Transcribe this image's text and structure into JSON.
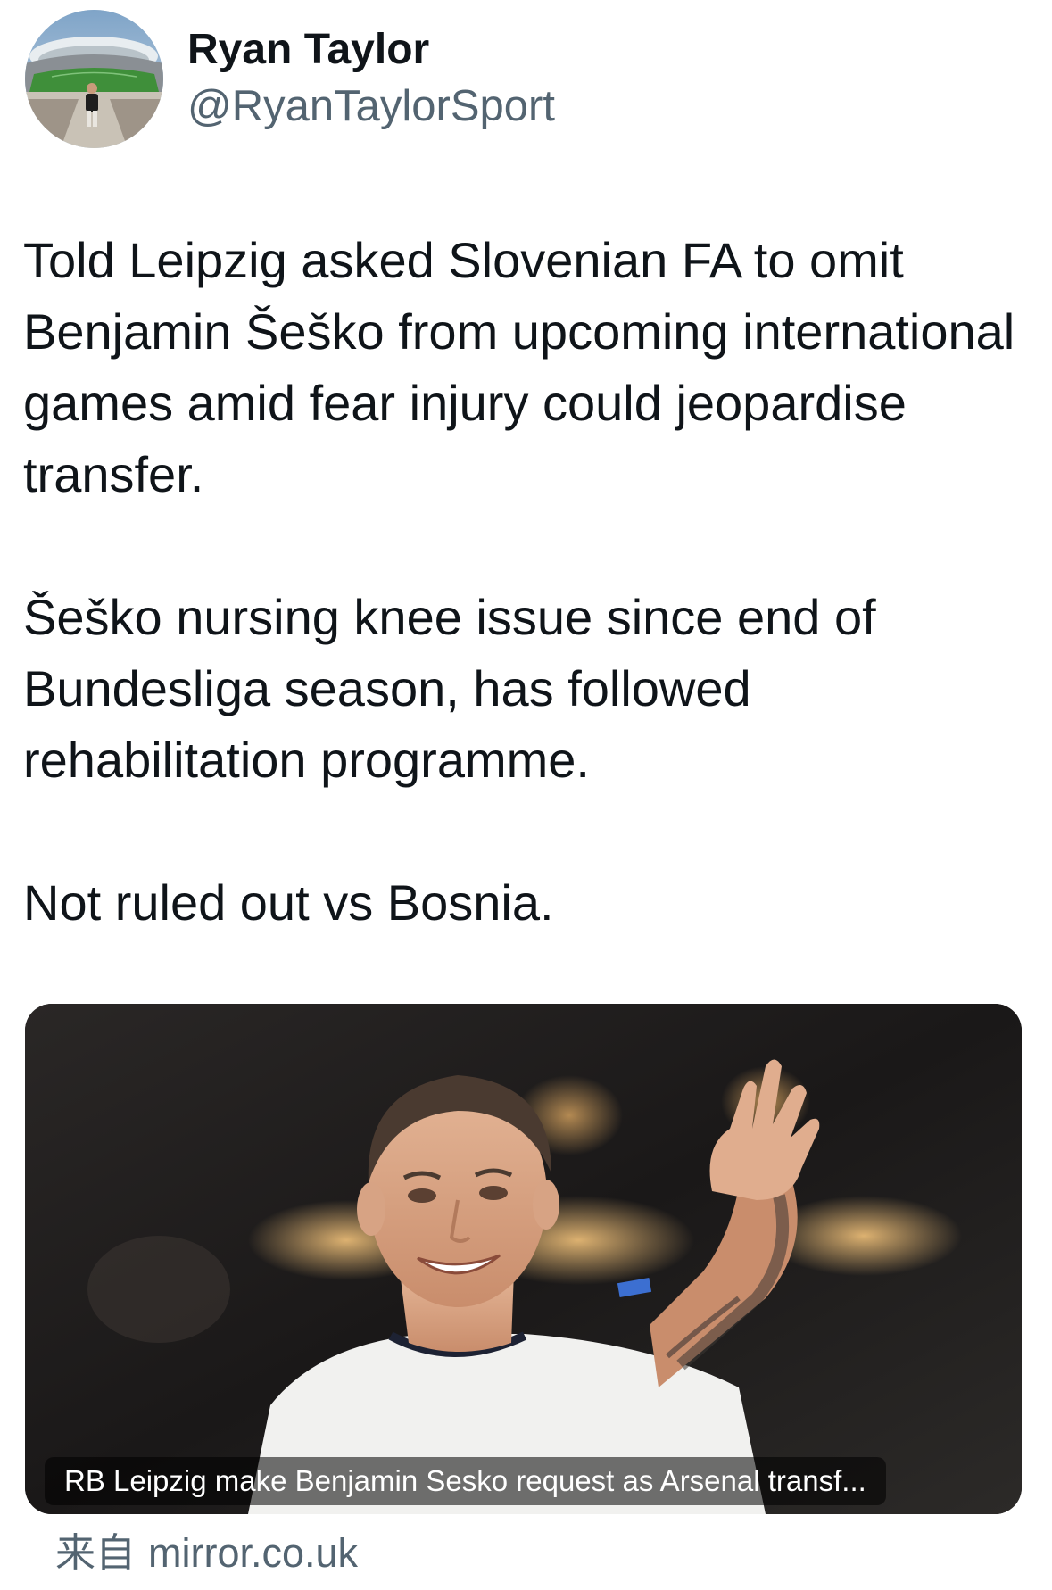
{
  "author": {
    "name": "Ryan Taylor",
    "handle": "@RyanTaylorSport"
  },
  "tweet": {
    "paragraphs": [
      "Told Leipzig asked Slovenian FA to omit Benjamin Šeško from upcoming international games amid fear injury could jeopardise transfer.",
      "Šeško nursing knee issue since end of Bundesliga season, has followed rehabilitation programme.",
      "Not ruled out vs Bosnia."
    ]
  },
  "link_card": {
    "caption": "RB Leipzig make Benjamin Sesko request as Arsenal transf..."
  },
  "source": {
    "prefix": "来自",
    "domain": "mirror.co.uk"
  },
  "colors": {
    "text_primary": "#0f1419",
    "text_secondary": "#536471",
    "background": "#ffffff"
  }
}
